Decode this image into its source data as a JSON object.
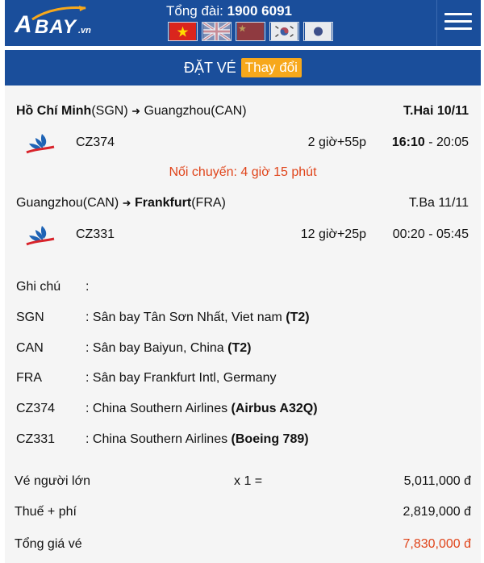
{
  "header": {
    "logo_main": "BAY",
    "logo_a": "A",
    "logo_vn": ".vn",
    "hotline_label": "Tổng đài:",
    "hotline_number": "1900 6091",
    "flags": [
      "vietnam-flag",
      "uk-flag",
      "china-flag",
      "korea-flag",
      "japan-flag"
    ]
  },
  "booking": {
    "title": "ĐẶT VÉ",
    "change_label": "Thay đổi"
  },
  "segments": [
    {
      "from_city": "Hồ Chí Minh",
      "from_code": "(SGN)",
      "to_city": "Guangzhou",
      "to_code": "(CAN)",
      "date": "T.Hai 10/11",
      "flight_no": "CZ374",
      "duration": "2 giờ+55p",
      "depart": "16:10",
      "arrive": "- 20:05"
    },
    {
      "from_city": "Guangzhou",
      "from_code": "(CAN)",
      "to_city": "Frankfurt",
      "to_code": "(FRA)",
      "date": "T.Ba 11/11",
      "flight_no": "CZ331",
      "duration": "12 giờ+25p",
      "depart": "00:20",
      "arrive": "- 05:45"
    }
  ],
  "transfer": "Nối chuyến: 4 giờ 15 phút",
  "notes": {
    "heading": "Ghi chú",
    "heading_colon": ":",
    "items": [
      {
        "key": "SGN",
        "value": ": Sân bay Tân Sơn Nhất, Viet nam ",
        "extra": "(T2)"
      },
      {
        "key": "CAN",
        "value": ": Sân bay Baiyun, China ",
        "extra": "(T2)"
      },
      {
        "key": "FRA",
        "value": ": Sân bay Frankfurt Intl, Germany",
        "extra": ""
      },
      {
        "key": "CZ374",
        "value": ":  China Southern Airlines ",
        "extra": " (Airbus A32Q)"
      },
      {
        "key": "CZ331",
        "value": ":  China Southern Airlines ",
        "extra": " (Boeing 789)"
      }
    ]
  },
  "prices": {
    "adult_label": "Vé người lớn",
    "adult_qty": "x 1 =",
    "adult_value": "5,011,000 đ",
    "tax_label": "Thuế + phí",
    "tax_value": "2,819,000 đ",
    "total_label": "Tổng giá vé",
    "total_value": "7,830,000 đ"
  },
  "colors": {
    "header": "#1a4e9b",
    "accent": "#f7a81b",
    "highlight": "#e0441a"
  }
}
